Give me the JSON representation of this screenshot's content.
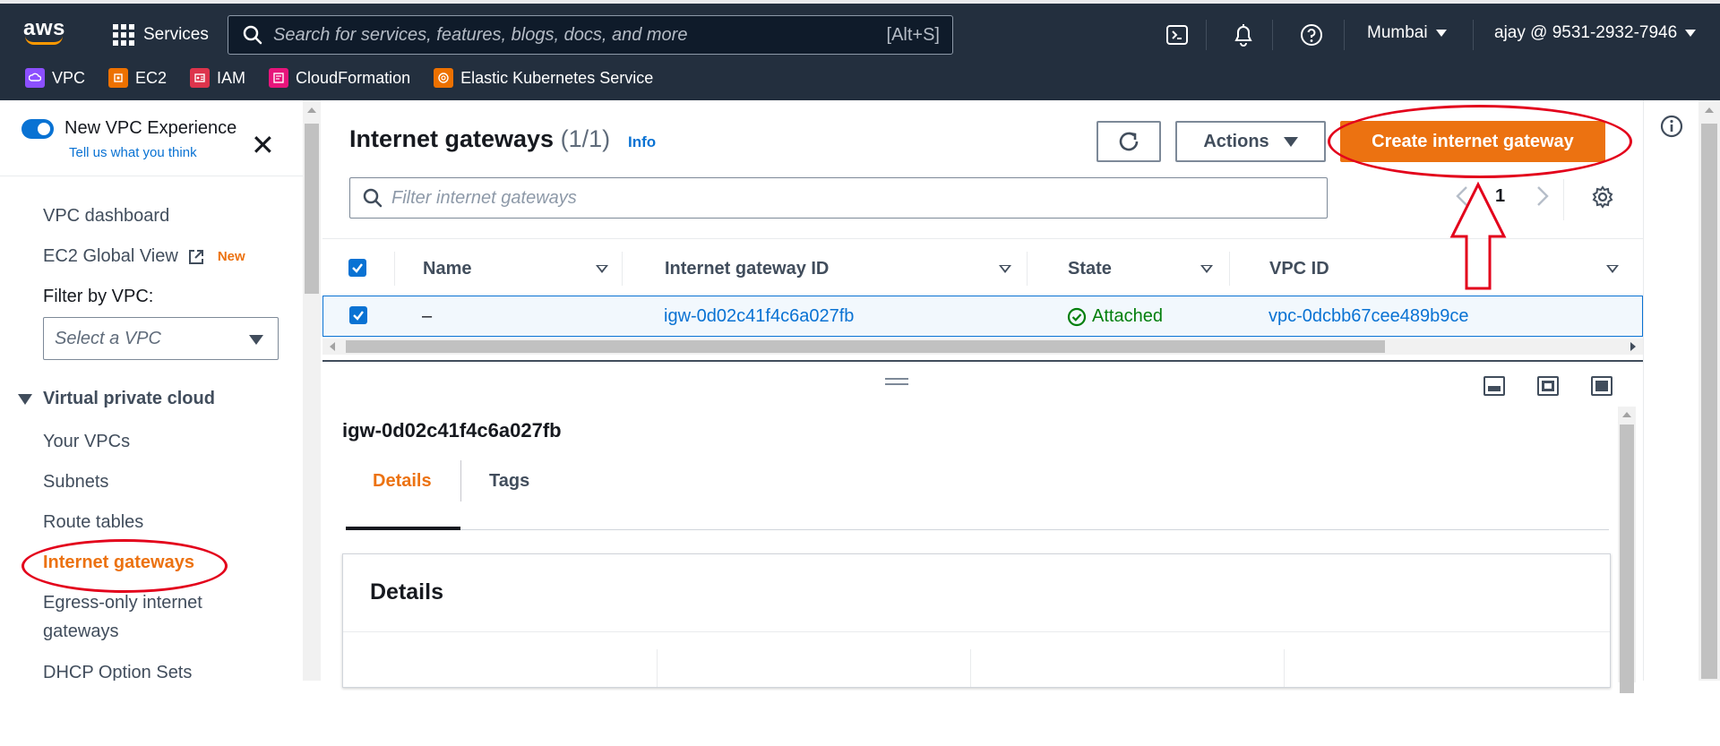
{
  "topnav": {
    "logo": "aws",
    "services_label": "Services",
    "search_placeholder": "Search for services, features, blogs, docs, and more",
    "search_shortcut": "[Alt+S]",
    "region": "Mumbai",
    "account": "ajay @ 9531-2932-7946",
    "icons": [
      "cloudshell-icon",
      "notifications-bell-icon",
      "help-icon"
    ],
    "favorites": [
      {
        "label": "VPC",
        "color": "#8c4fff"
      },
      {
        "label": "EC2",
        "color": "#ed7100"
      },
      {
        "label": "IAM",
        "color": "#dd344c"
      },
      {
        "label": "CloudFormation",
        "color": "#e7157b"
      },
      {
        "label": "Elastic Kubernetes Service",
        "color": "#ed7100"
      }
    ]
  },
  "sidebar": {
    "toggle_label": "New VPC Experience",
    "feedback_link": "Tell us what you think",
    "links": {
      "dashboard": "VPC dashboard",
      "global_view": "EC2 Global View",
      "new_badge": "New"
    },
    "filter_label": "Filter by VPC:",
    "filter_placeholder": "Select a VPC",
    "section": "Virtual private cloud",
    "items": [
      "Your VPCs",
      "Subnets",
      "Route tables",
      "Internet gateways",
      "Egress-only internet",
      "gateways",
      "DHCP Option Sets"
    ],
    "active_item": "Internet gateways"
  },
  "main": {
    "title": "Internet gateways",
    "count": "(1/1)",
    "info": "Info",
    "actions_label": "Actions",
    "create_label": "Create internet gateway",
    "filter_placeholder": "Filter internet gateways",
    "page_number": "1",
    "table": {
      "columns": [
        "Name",
        "Internet gateway ID",
        "State",
        "VPC ID"
      ],
      "rows": [
        {
          "name": "–",
          "id": "igw-0d02c41f4c6a027fb",
          "state": "Attached",
          "vpc": "vpc-0dcbb67cee489b9ce"
        }
      ]
    }
  },
  "detail": {
    "title": "igw-0d02c41f4c6a027fb",
    "tabs": [
      "Details",
      "Tags"
    ],
    "active_tab": "Details",
    "section_title": "Details"
  },
  "colors": {
    "accent_orange": "#ec7211",
    "link_blue": "#0972d3",
    "nav_bg": "#232f3e",
    "success_green": "#037f0c",
    "annotation_red": "#e3001b"
  }
}
